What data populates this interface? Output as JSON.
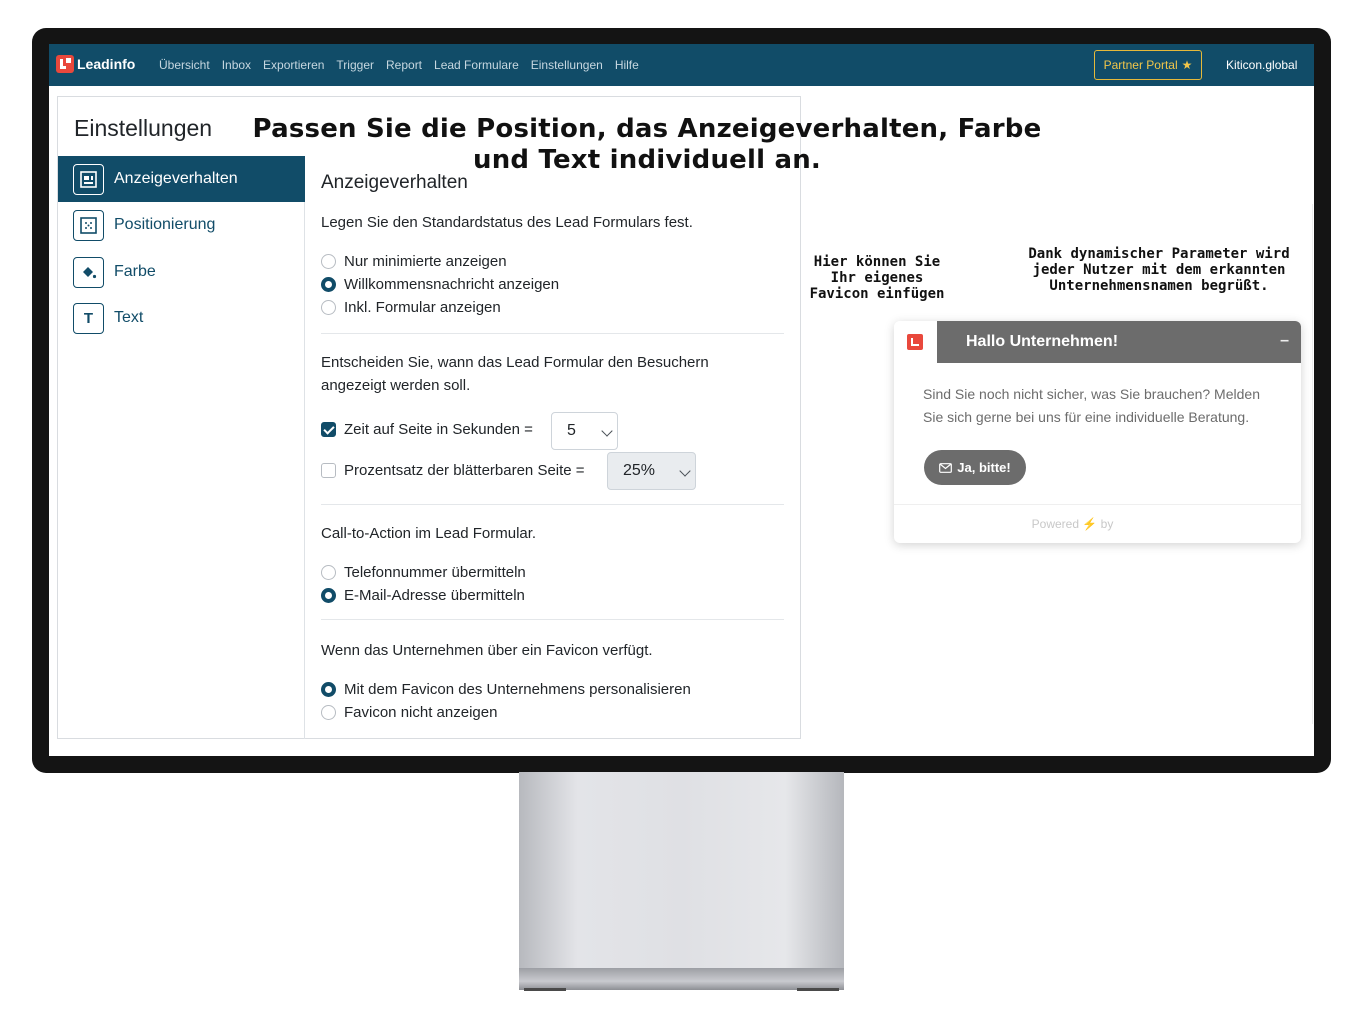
{
  "navbar": {
    "brand": "Leadinfo",
    "items": [
      "Übersicht",
      "Inbox",
      "Exportieren",
      "Trigger",
      "Report",
      "Lead Formulare",
      "Einstellungen",
      "Hilfe"
    ],
    "partner_portal": "Partner Portal",
    "account": "Kiticon.global"
  },
  "settings": {
    "title": "Einstellungen",
    "sidebar": [
      {
        "label": "Anzeigeverhalten",
        "icon": "layout-icon"
      },
      {
        "label": "Positionierung",
        "icon": "position-icon"
      },
      {
        "label": "Farbe",
        "icon": "paint-bucket-icon"
      },
      {
        "label": "Text",
        "icon": "text-icon"
      }
    ],
    "section_title": "Anzeigeverhalten",
    "default_state": {
      "prompt": "Legen Sie den Standardstatus des Lead Formulars fest.",
      "options": [
        "Nur minimierte anzeigen",
        "Willkommensnachricht anzeigen",
        "Inkl. Formular anzeigen"
      ],
      "selected_index": 1
    },
    "timing": {
      "prompt": "Entscheiden Sie, wann das Lead Formular den Besuchern angezeigt werden soll.",
      "time_label": "Zeit auf Seite in Sekunden =",
      "time_checked": true,
      "time_value": "5",
      "scroll_label": "Prozentsatz der blätterbaren Seite =",
      "scroll_checked": false,
      "scroll_value": "25%"
    },
    "cta": {
      "prompt": "Call-to-Action im Lead Formular.",
      "options": [
        "Telefonnummer übermitteln",
        "E-Mail-Adresse übermitteln"
      ],
      "selected_index": 1
    },
    "favicon": {
      "prompt": "Wenn das Unternehmen über ein Favicon verfügt.",
      "options": [
        "Mit dem Favicon des Unternehmens personalisieren",
        "Favicon nicht anzeigen"
      ],
      "selected_index": 0
    }
  },
  "overlay": {
    "heading": "Passen Sie die Position, das Anzeigeverhalten, Farbe und Text individuell an.",
    "note_favicon": "Hier können Sie Ihr eigenes Favicon einfügen",
    "note_params": "Dank dynamischer Parameter wird jeder Nutzer mit dem erkannten Unternehmensnamen begrüßt."
  },
  "widget": {
    "title": "Hallo Unternehmen!",
    "message": "Sind Sie noch nicht sicher, was Sie brauchen? Melden Sie sich gerne bei uns für eine individuelle Beratung.",
    "button": "Ja, bitte!",
    "powered_prefix": "Powered",
    "powered_suffix": "by",
    "theme_color": "#6c6c6c"
  },
  "colors": {
    "brand": "#114c68",
    "accent": "#e9483c",
    "partner": "#e5b93a"
  }
}
